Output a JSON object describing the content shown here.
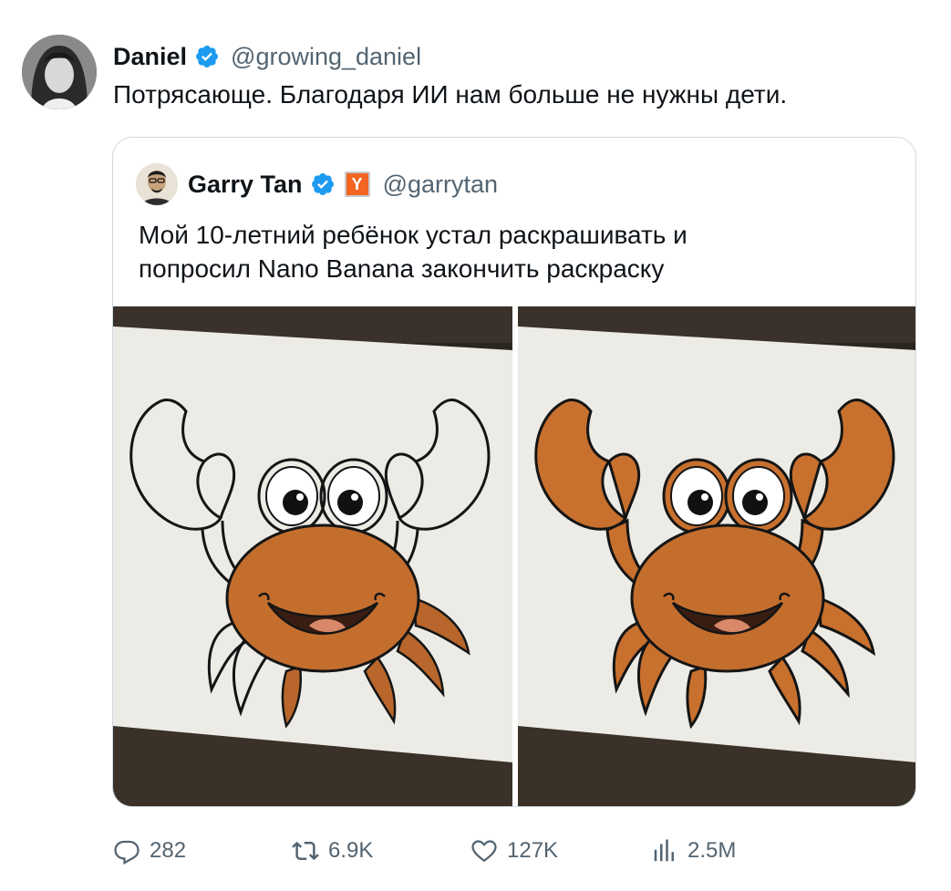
{
  "tweet": {
    "author_name": "Daniel",
    "author_handle": "@growing_daniel",
    "text": "Потрясающе. Благодаря ИИ нам больше не нужны дети."
  },
  "quoted_tweet": {
    "author_name": "Garry Tan",
    "badge_letter": "Y",
    "author_handle": "@garrytan",
    "text_lines": [
      "Мой 10-летний ребёнок устал раскрашивать и",
      "попросил Nano Banana закончить раскраску"
    ],
    "images": [
      {
        "icon": "crab-coloring-partial"
      },
      {
        "icon": "crab-coloring-complete"
      }
    ]
  },
  "actions": {
    "replies": "282",
    "reposts": "6.9K",
    "likes": "127K",
    "views": "2.5M"
  },
  "colors": {
    "verified": "#1d9bf0",
    "yc": "#f26522",
    "crab_orange": "#c8702e",
    "muted": "#536471"
  }
}
